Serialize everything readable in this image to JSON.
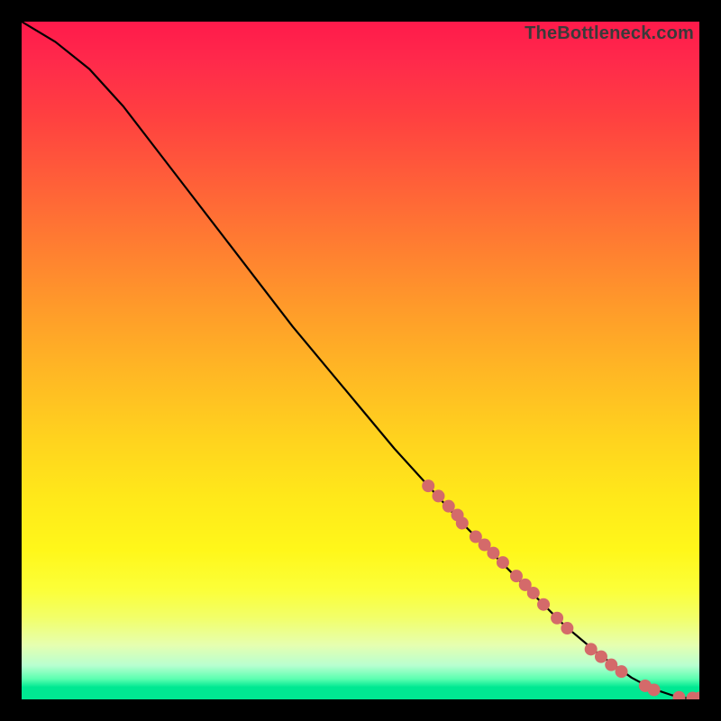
{
  "watermark": "TheBottleneck.com",
  "colors": {
    "bg": "#000000",
    "curve": "#000000",
    "marker_fill": "#d46a6a",
    "marker_stroke": "#b24a4a",
    "gradient_top": "#ff1a4b",
    "gradient_bottom": "#00e892"
  },
  "chart_data": {
    "type": "line",
    "title": "",
    "xlabel": "",
    "ylabel": "",
    "xlim": [
      0,
      100
    ],
    "ylim": [
      0,
      100
    ],
    "grid": false,
    "legend": false,
    "series": [
      {
        "name": "curve",
        "x": [
          0,
          5,
          10,
          15,
          20,
          25,
          30,
          35,
          40,
          45,
          50,
          55,
          60,
          65,
          70,
          75,
          80,
          85,
          90,
          93,
          96,
          98,
          100
        ],
        "y": [
          100,
          97,
          93,
          87.5,
          81,
          74.5,
          68,
          61.5,
          55,
          49,
          43,
          37,
          31.5,
          26,
          21,
          16,
          11,
          6.8,
          3.2,
          1.6,
          0.6,
          0.2,
          0.2
        ]
      }
    ],
    "markers": [
      {
        "x": 60.0,
        "y": 31.5
      },
      {
        "x": 61.5,
        "y": 30.0
      },
      {
        "x": 63.0,
        "y": 28.5
      },
      {
        "x": 64.3,
        "y": 27.2
      },
      {
        "x": 65.0,
        "y": 26.0
      },
      {
        "x": 67.0,
        "y": 24.0
      },
      {
        "x": 68.3,
        "y": 22.8
      },
      {
        "x": 69.6,
        "y": 21.6
      },
      {
        "x": 71.0,
        "y": 20.2
      },
      {
        "x": 73.0,
        "y": 18.2
      },
      {
        "x": 74.3,
        "y": 16.9
      },
      {
        "x": 75.5,
        "y": 15.7
      },
      {
        "x": 77.0,
        "y": 14.0
      },
      {
        "x": 79.0,
        "y": 12.0
      },
      {
        "x": 80.5,
        "y": 10.5
      },
      {
        "x": 84.0,
        "y": 7.4
      },
      {
        "x": 85.5,
        "y": 6.3
      },
      {
        "x": 87.0,
        "y": 5.1
      },
      {
        "x": 88.5,
        "y": 4.1
      },
      {
        "x": 92.0,
        "y": 2.0
      },
      {
        "x": 93.3,
        "y": 1.4
      },
      {
        "x": 97.0,
        "y": 0.3
      },
      {
        "x": 99.0,
        "y": 0.2
      },
      {
        "x": 100.0,
        "y": 0.2
      }
    ]
  }
}
